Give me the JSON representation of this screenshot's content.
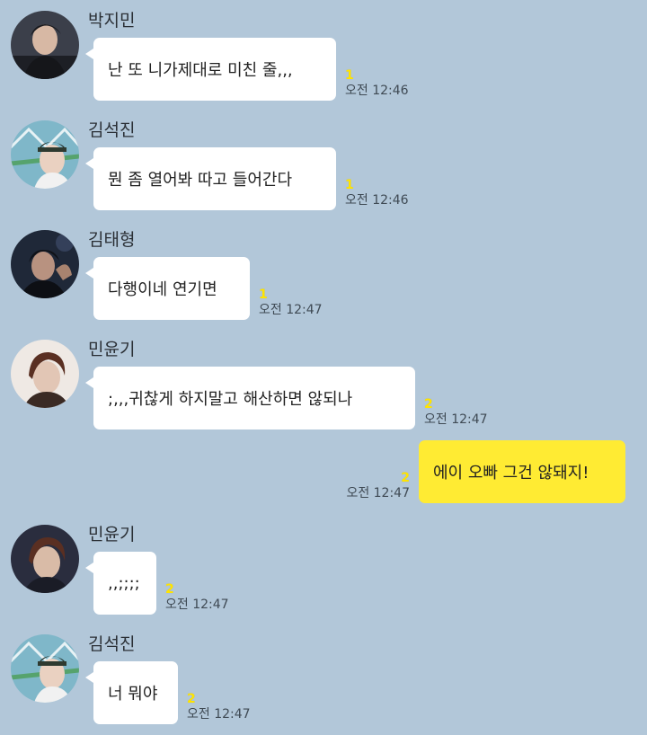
{
  "messages": [
    {
      "sender": "박지민",
      "text": "난 또 니가제대로 미친 줄,,,",
      "unread": "1",
      "time": "오전 12:46"
    },
    {
      "sender": "김석진",
      "text": "뭔 좀 열어봐 따고 들어간다",
      "unread": "1",
      "time": "오전 12:46"
    },
    {
      "sender": "김태형",
      "text": "다행이네 연기면",
      "unread": "1",
      "time": "오전 12:47"
    },
    {
      "sender": "민윤기",
      "text": ";,,,귀찮게 하지말고 해산하면 않되나",
      "unread": "2",
      "time": "오전 12:47"
    },
    {
      "sender": "",
      "text": "에이 오빠 그건 않돼지!",
      "unread": "2",
      "time": "오전 12:47"
    },
    {
      "sender": "민윤기",
      "text": ",,;;;;",
      "unread": "2",
      "time": "오전 12:47"
    },
    {
      "sender": "김석진",
      "text": "너 뭐야",
      "unread": "2",
      "time": "오전 12:47"
    }
  ],
  "colors": {
    "background": "#b2c7d9",
    "incoming_bubble": "#ffffff",
    "outgoing_bubble": "#ffeb33",
    "unread_count": "#ffe400"
  }
}
